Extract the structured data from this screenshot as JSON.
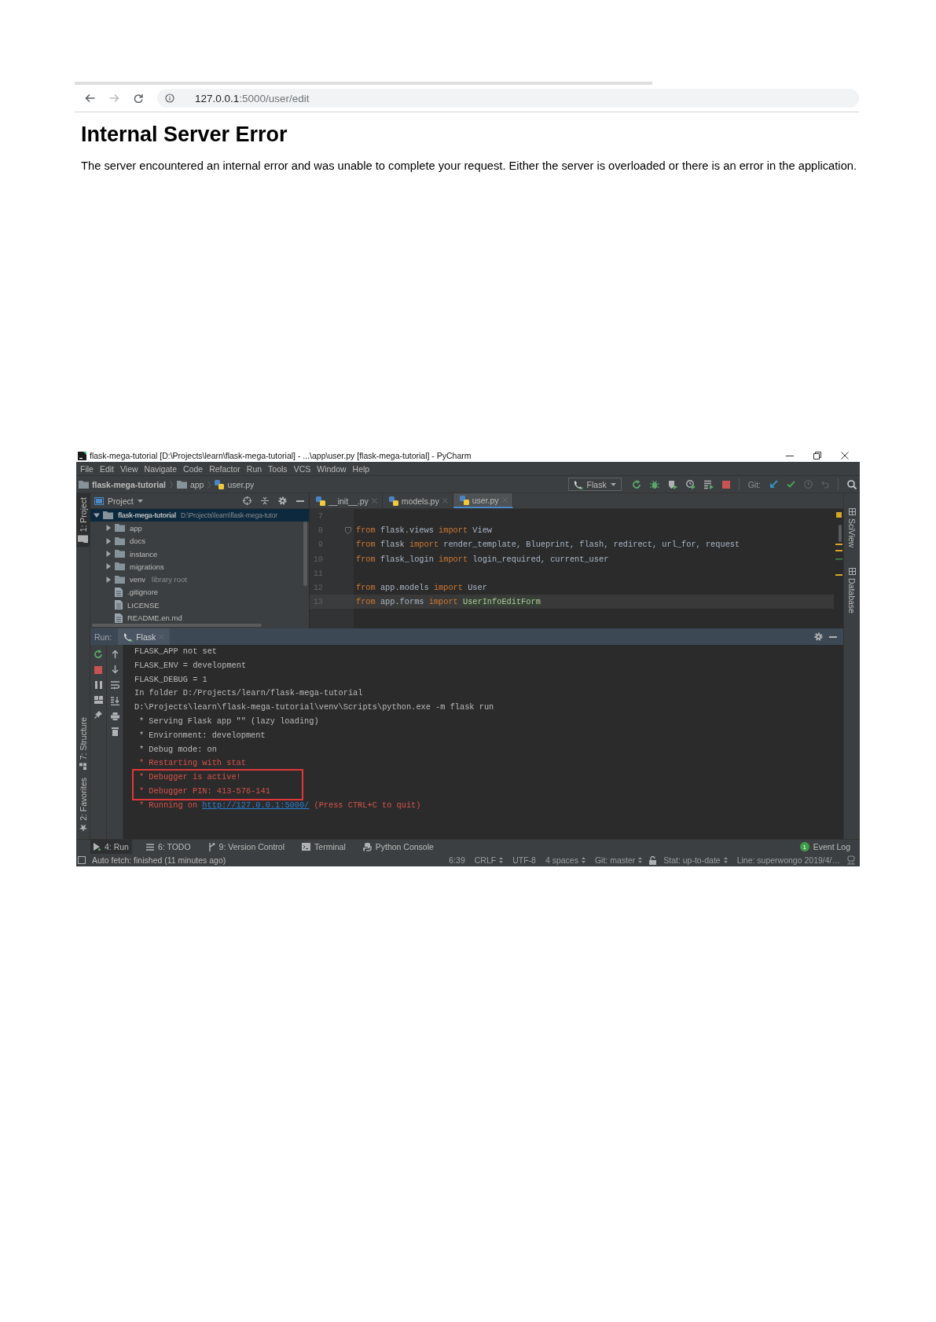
{
  "browser": {
    "address": {
      "host": "127.0.0.1",
      "rest": ":5000/user/edit"
    },
    "heading": "Internal Server Error",
    "message": "The server encountered an internal error and was unable to complete your request. Either the server is overloaded or there is an error in the application."
  },
  "ide": {
    "title": "flask-mega-tutorial [D:\\Projects\\learn\\flask-mega-tutorial] - ...\\app\\user.py [flask-mega-tutorial] - PyCharm",
    "menu": [
      "File",
      "Edit",
      "View",
      "Navigate",
      "Code",
      "Refactor",
      "Run",
      "Tools",
      "VCS",
      "Window",
      "Help"
    ],
    "breadcrumbs": [
      {
        "label": "flask-mega-tutorial",
        "kind": "project"
      },
      {
        "label": "app",
        "kind": "folder"
      },
      {
        "label": "user.py",
        "kind": "python"
      }
    ],
    "run_config": "Flask",
    "vcs_label": "Git:",
    "left_tools": [
      {
        "label": "1: Project",
        "kind": "project",
        "selected": true
      },
      {
        "label": "7: Structure",
        "kind": "structure",
        "selected": false
      },
      {
        "label": "2: Favorites",
        "kind": "favorites",
        "selected": false
      }
    ],
    "right_tools": [
      "SciView",
      "Database"
    ],
    "project": {
      "title": "Project",
      "tree": [
        {
          "label": "flask-mega-tutorial",
          "hint": "D:\\Projects\\learn\\flask-mega-tutor",
          "kind": "project",
          "expanded": true,
          "selected": true,
          "children": [
            {
              "label": "app",
              "kind": "folder",
              "expanded": false,
              "selected": false
            },
            {
              "label": "docs",
              "kind": "folder",
              "expanded": false,
              "selected": false
            },
            {
              "label": "instance",
              "kind": "folder",
              "expanded": false,
              "selected": false
            },
            {
              "label": "migrations",
              "kind": "folder",
              "expanded": false,
              "selected": false
            },
            {
              "label": "venv",
              "hint": "library root",
              "kind": "folder",
              "expanded": false,
              "selected": false
            },
            {
              "label": ".gitignore",
              "kind": "file",
              "selected": false
            },
            {
              "label": "LICENSE",
              "kind": "file",
              "selected": false
            },
            {
              "label": "README.en.md",
              "kind": "markdown",
              "selected": false
            }
          ]
        }
      ]
    },
    "editor": {
      "tabs": [
        {
          "label": "__init__.py",
          "selected": false
        },
        {
          "label": "models.py",
          "selected": false
        },
        {
          "label": "user.py",
          "selected": true
        }
      ],
      "lines": [
        {
          "number": "7",
          "fold": false,
          "current": false
        },
        {
          "number": "8",
          "fold": true,
          "current": false,
          "tokens": [
            {
              "text": "from",
              "kind": "keyword"
            },
            {
              "text": " flask.views ",
              "kind": "plain"
            },
            {
              "text": "import",
              "kind": "keyword"
            },
            {
              "text": " View",
              "kind": "plain"
            }
          ]
        },
        {
          "number": "9",
          "fold": false,
          "current": false,
          "tokens": [
            {
              "text": "from",
              "kind": "keyword"
            },
            {
              "text": " flask ",
              "kind": "plain"
            },
            {
              "text": "import",
              "kind": "keyword"
            },
            {
              "text": " render_template, Blueprint, flash, redirect, url_for, request",
              "kind": "plain"
            }
          ]
        },
        {
          "number": "10",
          "fold": false,
          "current": false,
          "tokens": [
            {
              "text": "from",
              "kind": "keyword"
            },
            {
              "text": " flask_login ",
              "kind": "plain"
            },
            {
              "text": "import",
              "kind": "keyword"
            },
            {
              "text": " login_required, current_user",
              "kind": "plain"
            }
          ]
        },
        {
          "number": "11",
          "fold": false,
          "current": false
        },
        {
          "number": "12",
          "fold": false,
          "current": false,
          "tokens": [
            {
              "text": "from",
              "kind": "keyword"
            },
            {
              "text": " app.models ",
              "kind": "plain"
            },
            {
              "text": "import",
              "kind": "keyword"
            },
            {
              "text": " User",
              "kind": "plain"
            }
          ]
        },
        {
          "number": "13",
          "fold": false,
          "current": true,
          "tokens": [
            {
              "text": "from",
              "kind": "keyword"
            },
            {
              "text": " app.forms ",
              "kind": "plain"
            },
            {
              "text": "import ",
              "kind": "keyword"
            },
            {
              "text": "UserInfoEditForm",
              "kind": "highlight"
            }
          ]
        }
      ]
    },
    "run": {
      "label": "Run:",
      "tab": "Flask",
      "lines": [
        {
          "indented": false,
          "boxed": false,
          "segments": [
            {
              "text": "FLASK_APP not set",
              "kind": "plain"
            }
          ]
        },
        {
          "indented": false,
          "boxed": false,
          "segments": [
            {
              "text": "FLASK_ENV = development",
              "kind": "plain"
            }
          ]
        },
        {
          "indented": false,
          "boxed": false,
          "segments": [
            {
              "text": "FLASK_DEBUG = 1",
              "kind": "plain"
            }
          ]
        },
        {
          "indented": false,
          "boxed": false,
          "segments": [
            {
              "text": "In folder D:/Projects/learn/flask-mega-tutorial",
              "kind": "plain"
            }
          ]
        },
        {
          "indented": false,
          "boxed": false,
          "segments": [
            {
              "text": "D:\\Projects\\learn\\flask-mega-tutorial\\venv\\Scripts\\python.exe -m flask run",
              "kind": "plain"
            }
          ]
        },
        {
          "indented": true,
          "boxed": false,
          "segments": [
            {
              "text": "* Serving Flask app \"\" (lazy loading)",
              "kind": "plain"
            }
          ]
        },
        {
          "indented": true,
          "boxed": false,
          "segments": [
            {
              "text": "* Environment: development",
              "kind": "plain"
            }
          ]
        },
        {
          "indented": true,
          "boxed": false,
          "segments": [
            {
              "text": "* Debug mode: on",
              "kind": "plain"
            }
          ]
        },
        {
          "indented": true,
          "boxed": false,
          "segments": [
            {
              "text": "* Restarting with stat",
              "kind": "error"
            }
          ]
        },
        {
          "indented": true,
          "boxed": true,
          "segments": [
            {
              "text": "* Debugger is active!",
              "kind": "error"
            }
          ]
        },
        {
          "indented": true,
          "boxed": true,
          "segments": [
            {
              "text": "* Debugger PIN: 413-576-141",
              "kind": "error"
            }
          ]
        },
        {
          "indented": true,
          "boxed": false,
          "segments": [
            {
              "text": "* Running on ",
              "kind": "error"
            },
            {
              "text": "http://127.0.0.1:5000/",
              "kind": "link"
            },
            {
              "text": " (Press CTRL+C to quit)",
              "kind": "error"
            }
          ]
        }
      ]
    },
    "bottom_tabs": [
      {
        "label": "4: Run",
        "kind": "run",
        "selected": true
      },
      {
        "label": "6: TODO",
        "kind": "todo",
        "selected": false
      },
      {
        "label": "9: Version Control",
        "kind": "vcs",
        "selected": false
      },
      {
        "label": "Terminal",
        "kind": "terminal",
        "selected": false
      },
      {
        "label": "Python Console",
        "kind": "python",
        "selected": false
      }
    ],
    "event_log": {
      "count": "1",
      "label": "Event Log"
    },
    "status": {
      "message": "Auto fetch: finished (11 minutes ago)",
      "items": [
        {
          "kind": "text",
          "text": "6:39",
          "dropdown": false
        },
        {
          "kind": "text",
          "text": "CRLF",
          "dropdown": true
        },
        {
          "kind": "text",
          "text": "UTF-8",
          "dropdown": false
        },
        {
          "kind": "text",
          "text": "4 spaces",
          "dropdown": true
        },
        {
          "kind": "text",
          "text": "Git: master",
          "dropdown": true
        },
        {
          "kind": "lock"
        },
        {
          "kind": "text",
          "text": "Stat: up-to-date",
          "dropdown": true
        },
        {
          "kind": "text",
          "text": "Line: superwongo 2019/4/…",
          "dropdown": false
        }
      ]
    }
  }
}
